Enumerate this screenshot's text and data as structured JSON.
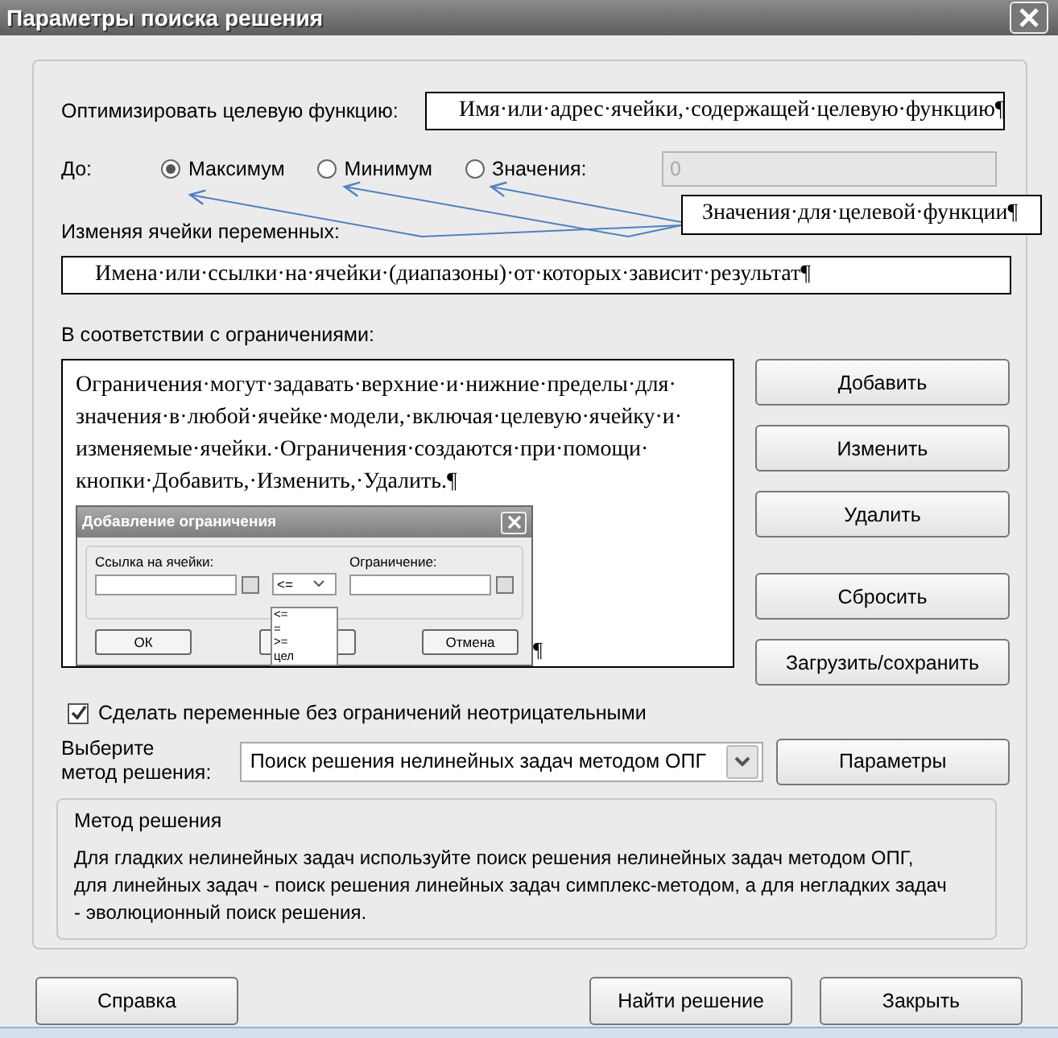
{
  "window": {
    "title": "Параметры поиска решения"
  },
  "objective": {
    "label": "Оптимизировать целевую функцию:",
    "annotation": "Имя·или·адрес·ячейки,·содержащей·целевую·функцию¶"
  },
  "to": {
    "label": "До:",
    "options": [
      {
        "label": "Максимум",
        "selected": true
      },
      {
        "label": "Минимум",
        "selected": false
      },
      {
        "label": "Значения:",
        "selected": false
      }
    ],
    "value_field": {
      "value": "0",
      "disabled": true
    },
    "annotation": "Значения·для·целевой·функции¶"
  },
  "variables": {
    "label": "Изменяя ячейки переменных:",
    "annotation": "Имена·или·ссылки·на·ячейки·(диапазоны)·от·которых·зависит·результат¶"
  },
  "constraints": {
    "label": "В соответствии с ограничениями:",
    "note": "Ограничения·могут·задавать·верхние·и·нижние·пределы·для·значения·в·любой·ячейке·модели,·включая·целевую·ячейку·и·изменяемые·ячейки.·Ограничения·создаются·при·помощи·кнопки·Добавить,·Изменить,·Удалить.¶",
    "note_end": "¶",
    "embedded_dialog": {
      "title": "Добавление ограничения",
      "cell_label": "Ссылка на ячейки:",
      "constraint_label": "Ограничение:",
      "operator": "<=",
      "operator_options": [
        "<=",
        "=",
        ">=",
        "цел"
      ],
      "buttons": [
        "ОК",
        "Отмена"
      ]
    },
    "buttons": [
      "Добавить",
      "Изменить",
      "Удалить",
      "Сбросить",
      "Загрузить/сохранить"
    ]
  },
  "nonnegative": {
    "label": "Сделать переменные без ограничений неотрицательными",
    "checked": true
  },
  "method": {
    "label": [
      "Выберите",
      "метод решения:"
    ],
    "value": "Поиск решения нелинейных задач методом ОПГ",
    "button": "Параметры"
  },
  "method_info": {
    "title": "Метод решения",
    "text": "Для гладких нелинейных задач используйте поиск решения нелинейных задач методом ОПГ, для линейных задач - поиск решения линейных задач симплекс-методом, а для негладких задач - эволюционный поиск решения."
  },
  "footer_buttons": [
    {
      "label": "Справка",
      "kind": "left"
    },
    {
      "label": "Найти решение",
      "kind": "right"
    },
    {
      "label": "Закрыть",
      "kind": "right"
    }
  ]
}
